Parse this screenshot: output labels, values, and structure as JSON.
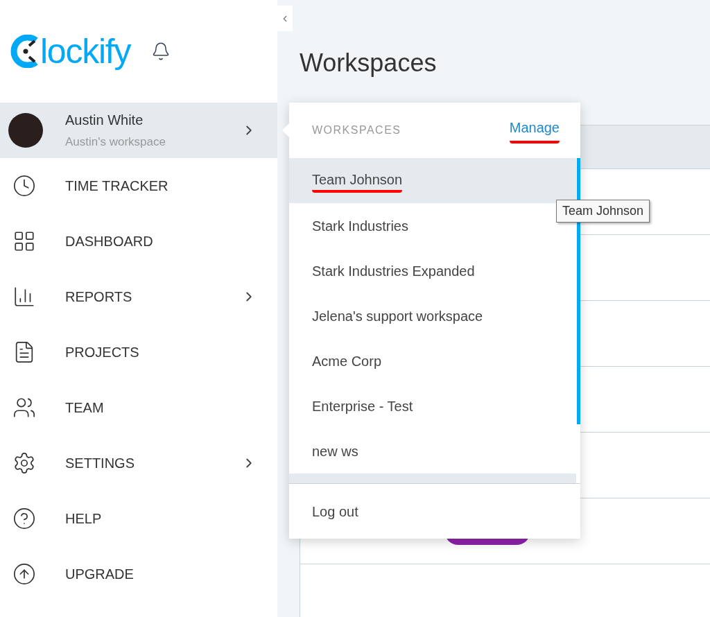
{
  "sidebar": {
    "logo": "lockify",
    "user": {
      "name": "Austin White",
      "workspace": "Austin's workspace",
      "selected": true
    },
    "items": [
      {
        "label": "TIME TRACKER",
        "kind": "clock",
        "submenu": false
      },
      {
        "label": "DASHBOARD",
        "kind": "grid",
        "submenu": false
      },
      {
        "label": "REPORTS",
        "kind": "chart",
        "submenu": true
      },
      {
        "label": "PROJECTS",
        "kind": "file",
        "submenu": false
      },
      {
        "label": "TEAM",
        "kind": "users",
        "submenu": false
      },
      {
        "label": "SETTINGS",
        "kind": "settings",
        "submenu": true
      },
      {
        "label": "HELP",
        "kind": "help",
        "submenu": false
      },
      {
        "label": "UPGRADE",
        "kind": "upgrade",
        "submenu": false
      }
    ]
  },
  "page": {
    "title": "Workspaces"
  },
  "dropdown": {
    "heading": "WORKSPACES",
    "manage": {
      "label": "Manage",
      "underlined": true
    },
    "workspaces": [
      {
        "name": "Team Johnson",
        "selected": true,
        "underlined": true
      },
      {
        "name": "Stark Industries",
        "selected": false,
        "underlined": false
      },
      {
        "name": "Stark Industries Expanded",
        "selected": false,
        "underlined": false
      },
      {
        "name": "Jelena's support workspace",
        "selected": false,
        "underlined": false
      },
      {
        "name": "Acme Corp",
        "selected": false,
        "underlined": false
      },
      {
        "name": "Enterprise - Test",
        "selected": false,
        "underlined": false
      },
      {
        "name": "new ws",
        "selected": false,
        "underlined": false
      }
    ],
    "logout": "Log out"
  },
  "tooltip": "Team Johnson"
}
